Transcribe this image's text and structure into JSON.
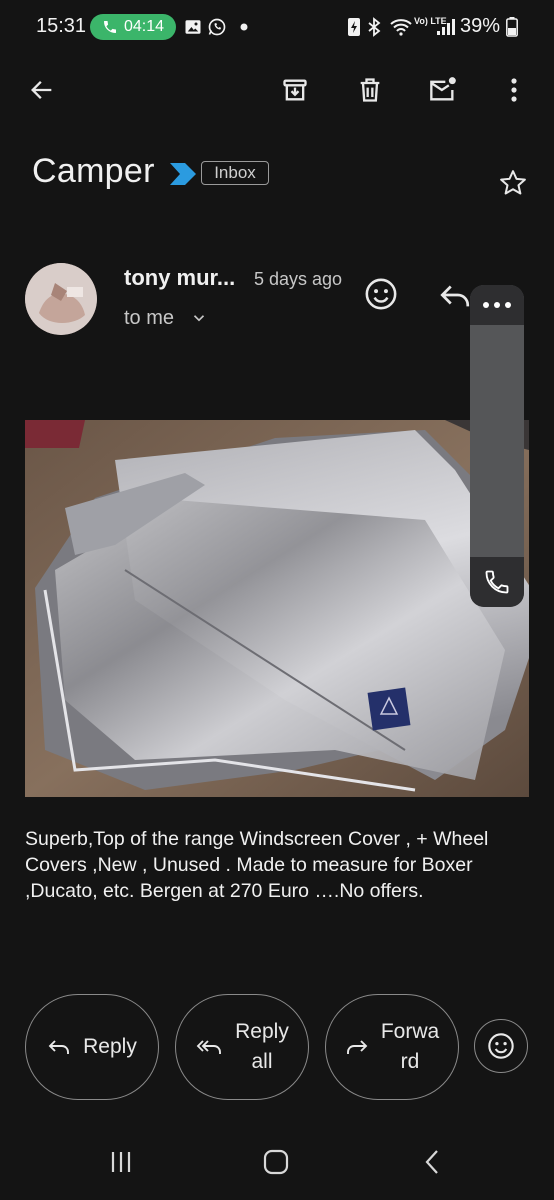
{
  "status_bar": {
    "time": "15:31",
    "call_duration": "04:14",
    "battery": "39%",
    "network": "Vo) LTE"
  },
  "toolbar": {
    "back_icon": "arrow-left",
    "icons": [
      "archive-icon",
      "trash-icon",
      "mark-unread-icon",
      "more-vert-icon"
    ]
  },
  "email": {
    "subject": "Camper",
    "label": "Inbox",
    "sender": "tony mur...",
    "date": "5 days ago",
    "recipient": "to me",
    "body": "Superb,Top of the range Windscreen Cover , + Wheel Covers ,New , Unused . Made to measure for Boxer ,Ducato, etc. Bergen at 270 Euro ….No offers."
  },
  "actions": {
    "reply": "Reply",
    "reply_all_l1": "Reply",
    "reply_all_l2": "all",
    "forward_l1": "Forwa",
    "forward_l2": "rd"
  },
  "colors": {
    "background": "#141414",
    "call_pill": "#3bb56a",
    "importance_marker": "#2b9be0"
  }
}
